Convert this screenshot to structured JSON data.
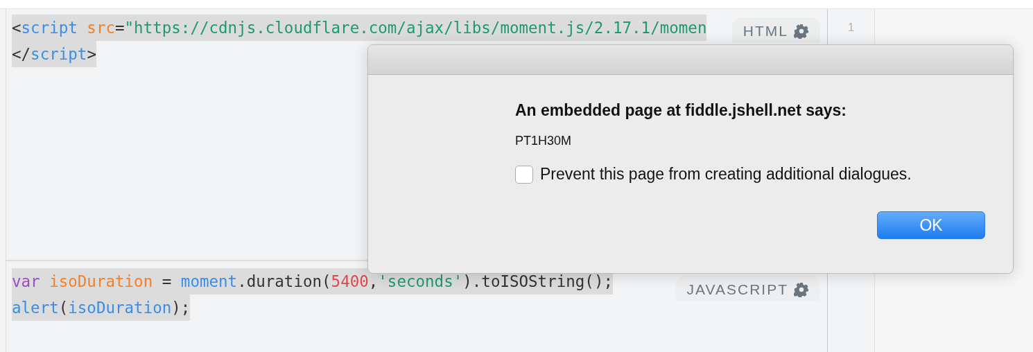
{
  "html_panel": {
    "label": "HTML",
    "lines": [
      [
        {
          "text": "<",
          "kind": "punct"
        },
        {
          "text": "script",
          "kind": "tag"
        },
        {
          "text": " src",
          "kind": "attr"
        },
        {
          "text": "=",
          "kind": "punct"
        },
        {
          "text": "\"https://cdnjs.cloudflare.com/ajax/libs/moment.js/2.17.1/momen",
          "kind": "string"
        }
      ],
      [
        {
          "text": "</",
          "kind": "punct"
        },
        {
          "text": "script",
          "kind": "tag"
        },
        {
          "text": ">",
          "kind": "punct"
        }
      ]
    ]
  },
  "js_panel": {
    "label": "JAVASCRIPT",
    "lines": [
      [
        {
          "text": "var",
          "kind": "keyword"
        },
        {
          "text": " isoDuration",
          "kind": "variable"
        },
        {
          "text": " = ",
          "kind": "plain"
        },
        {
          "text": "moment",
          "kind": "builtin"
        },
        {
          "text": ".duration(",
          "kind": "plain"
        },
        {
          "text": "5400",
          "kind": "number"
        },
        {
          "text": ",",
          "kind": "plain"
        },
        {
          "text": "'seconds'",
          "kind": "string"
        },
        {
          "text": ").toISOString();",
          "kind": "plain"
        }
      ],
      [
        {
          "text": "alert",
          "kind": "builtin"
        },
        {
          "text": "(",
          "kind": "plain"
        },
        {
          "text": "isoDuration",
          "kind": "builtin"
        },
        {
          "text": ");",
          "kind": "plain"
        }
      ]
    ]
  },
  "result_panel": {
    "line_number": "1"
  },
  "dialog": {
    "title": "An embedded page at fiddle.jshell.net says:",
    "message": "PT1H30M",
    "checkbox": {
      "label": "Prevent this page from creating additional dialogues.",
      "checked": false
    },
    "button": "OK"
  }
}
